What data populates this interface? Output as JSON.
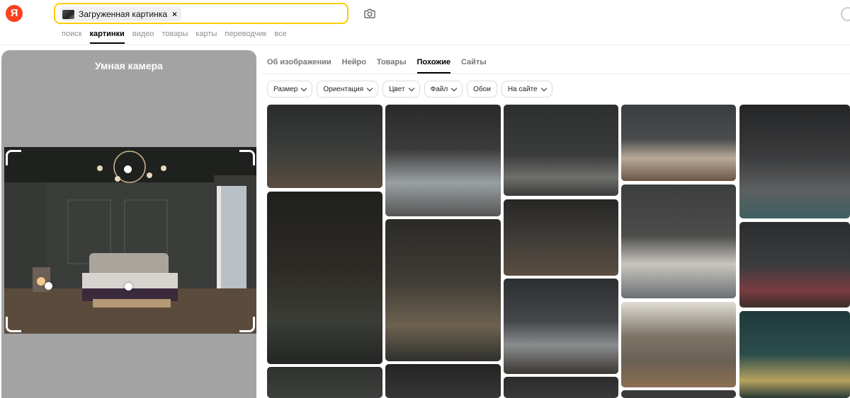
{
  "header": {
    "logo": "Я",
    "search_chip": "Загруженная картинка",
    "search_chip_close": "×",
    "camera_icon": "camera-icon",
    "nav": [
      "поиск",
      "картинки",
      "видео",
      "товары",
      "карты",
      "переводчик",
      "все"
    ],
    "nav_active": "картинки"
  },
  "left_panel": {
    "title": "Умная камера"
  },
  "tabs": [
    "Об изображении",
    "Нейро",
    "Товары",
    "Похожие",
    "Сайты"
  ],
  "tabs_active": "Похожие",
  "filters": [
    {
      "label": "Размер",
      "has_dropdown": true
    },
    {
      "label": "Ориентация",
      "has_dropdown": true
    },
    {
      "label": "Цвет",
      "has_dropdown": true
    },
    {
      "label": "Файл",
      "has_dropdown": true
    },
    {
      "label": "Обои",
      "has_dropdown": false
    },
    {
      "label": "На сайте",
      "has_dropdown": true
    }
  ],
  "colors": {
    "accent_yellow": "#ffcc00",
    "logo_red": "#fc3f1d",
    "panel_gray": "#a3a3a3"
  }
}
